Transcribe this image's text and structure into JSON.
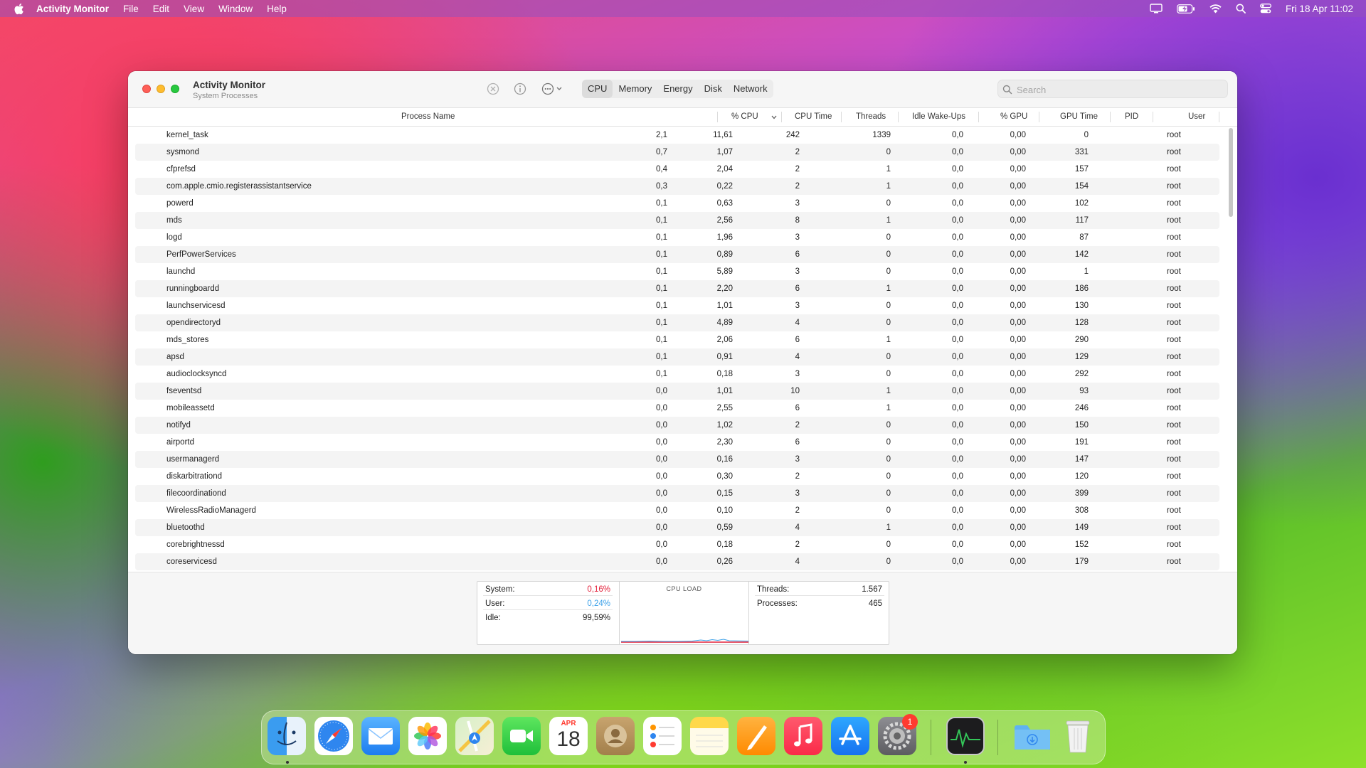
{
  "menubar": {
    "items": [
      "Activity Monitor",
      "File",
      "Edit",
      "View",
      "Window",
      "Help"
    ],
    "clock": "Fri 18 Apr  11:02",
    "status_icons": [
      "display-icon",
      "battery-icon",
      "wifi-icon",
      "search-icon",
      "control-center-icon"
    ]
  },
  "window": {
    "title": "Activity Monitor",
    "subtitle": "System Processes",
    "tabs": [
      "CPU",
      "Memory",
      "Energy",
      "Disk",
      "Network"
    ],
    "active_tab": "CPU",
    "search_placeholder": "Search"
  },
  "columns": [
    "Process Name",
    "% CPU",
    "CPU Time",
    "Threads",
    "Idle Wake-Ups",
    "% GPU",
    "GPU Time",
    "PID",
    "User"
  ],
  "sort_column": "% CPU",
  "processes": [
    {
      "name": "kernel_task",
      "cpu": "2,1",
      "cpu_time": "11,61",
      "threads": "242",
      "idle": "1339",
      "gpu": "0,0",
      "gpu_time": "0,00",
      "pid": "0",
      "user": "root"
    },
    {
      "name": "sysmond",
      "cpu": "0,7",
      "cpu_time": "1,07",
      "threads": "2",
      "idle": "0",
      "gpu": "0,0",
      "gpu_time": "0,00",
      "pid": "331",
      "user": "root"
    },
    {
      "name": "cfprefsd",
      "cpu": "0,4",
      "cpu_time": "2,04",
      "threads": "2",
      "idle": "1",
      "gpu": "0,0",
      "gpu_time": "0,00",
      "pid": "157",
      "user": "root"
    },
    {
      "name": "com.apple.cmio.registerassistantservice",
      "cpu": "0,3",
      "cpu_time": "0,22",
      "threads": "2",
      "idle": "1",
      "gpu": "0,0",
      "gpu_time": "0,00",
      "pid": "154",
      "user": "root"
    },
    {
      "name": "powerd",
      "cpu": "0,1",
      "cpu_time": "0,63",
      "threads": "3",
      "idle": "0",
      "gpu": "0,0",
      "gpu_time": "0,00",
      "pid": "102",
      "user": "root"
    },
    {
      "name": "mds",
      "cpu": "0,1",
      "cpu_time": "2,56",
      "threads": "8",
      "idle": "1",
      "gpu": "0,0",
      "gpu_time": "0,00",
      "pid": "117",
      "user": "root"
    },
    {
      "name": "logd",
      "cpu": "0,1",
      "cpu_time": "1,96",
      "threads": "3",
      "idle": "0",
      "gpu": "0,0",
      "gpu_time": "0,00",
      "pid": "87",
      "user": "root"
    },
    {
      "name": "PerfPowerServices",
      "cpu": "0,1",
      "cpu_time": "0,89",
      "threads": "6",
      "idle": "0",
      "gpu": "0,0",
      "gpu_time": "0,00",
      "pid": "142",
      "user": "root"
    },
    {
      "name": "launchd",
      "cpu": "0,1",
      "cpu_time": "5,89",
      "threads": "3",
      "idle": "0",
      "gpu": "0,0",
      "gpu_time": "0,00",
      "pid": "1",
      "user": "root"
    },
    {
      "name": "runningboardd",
      "cpu": "0,1",
      "cpu_time": "2,20",
      "threads": "6",
      "idle": "1",
      "gpu": "0,0",
      "gpu_time": "0,00",
      "pid": "186",
      "user": "root"
    },
    {
      "name": "launchservicesd",
      "cpu": "0,1",
      "cpu_time": "1,01",
      "threads": "3",
      "idle": "0",
      "gpu": "0,0",
      "gpu_time": "0,00",
      "pid": "130",
      "user": "root"
    },
    {
      "name": "opendirectoryd",
      "cpu": "0,1",
      "cpu_time": "4,89",
      "threads": "4",
      "idle": "0",
      "gpu": "0,0",
      "gpu_time": "0,00",
      "pid": "128",
      "user": "root"
    },
    {
      "name": "mds_stores",
      "cpu": "0,1",
      "cpu_time": "2,06",
      "threads": "6",
      "idle": "1",
      "gpu": "0,0",
      "gpu_time": "0,00",
      "pid": "290",
      "user": "root"
    },
    {
      "name": "apsd",
      "cpu": "0,1",
      "cpu_time": "0,91",
      "threads": "4",
      "idle": "0",
      "gpu": "0,0",
      "gpu_time": "0,00",
      "pid": "129",
      "user": "root"
    },
    {
      "name": "audioclocksyncd",
      "cpu": "0,1",
      "cpu_time": "0,18",
      "threads": "3",
      "idle": "0",
      "gpu": "0,0",
      "gpu_time": "0,00",
      "pid": "292",
      "user": "root"
    },
    {
      "name": "fseventsd",
      "cpu": "0,0",
      "cpu_time": "1,01",
      "threads": "10",
      "idle": "1",
      "gpu": "0,0",
      "gpu_time": "0,00",
      "pid": "93",
      "user": "root"
    },
    {
      "name": "mobileassetd",
      "cpu": "0,0",
      "cpu_time": "2,55",
      "threads": "6",
      "idle": "1",
      "gpu": "0,0",
      "gpu_time": "0,00",
      "pid": "246",
      "user": "root"
    },
    {
      "name": "notifyd",
      "cpu": "0,0",
      "cpu_time": "1,02",
      "threads": "2",
      "idle": "0",
      "gpu": "0,0",
      "gpu_time": "0,00",
      "pid": "150",
      "user": "root"
    },
    {
      "name": "airportd",
      "cpu": "0,0",
      "cpu_time": "2,30",
      "threads": "6",
      "idle": "0",
      "gpu": "0,0",
      "gpu_time": "0,00",
      "pid": "191",
      "user": "root"
    },
    {
      "name": "usermanagerd",
      "cpu": "0,0",
      "cpu_time": "0,16",
      "threads": "3",
      "idle": "0",
      "gpu": "0,0",
      "gpu_time": "0,00",
      "pid": "147",
      "user": "root"
    },
    {
      "name": "diskarbitrationd",
      "cpu": "0,0",
      "cpu_time": "0,30",
      "threads": "2",
      "idle": "0",
      "gpu": "0,0",
      "gpu_time": "0,00",
      "pid": "120",
      "user": "root"
    },
    {
      "name": "filecoordinationd",
      "cpu": "0,0",
      "cpu_time": "0,15",
      "threads": "3",
      "idle": "0",
      "gpu": "0,0",
      "gpu_time": "0,00",
      "pid": "399",
      "user": "root"
    },
    {
      "name": "WirelessRadioManagerd",
      "cpu": "0,0",
      "cpu_time": "0,10",
      "threads": "2",
      "idle": "0",
      "gpu": "0,0",
      "gpu_time": "0,00",
      "pid": "308",
      "user": "root"
    },
    {
      "name": "bluetoothd",
      "cpu": "0,0",
      "cpu_time": "0,59",
      "threads": "4",
      "idle": "1",
      "gpu": "0,0",
      "gpu_time": "0,00",
      "pid": "149",
      "user": "root"
    },
    {
      "name": "corebrightnessd",
      "cpu": "0,0",
      "cpu_time": "0,18",
      "threads": "2",
      "idle": "0",
      "gpu": "0,0",
      "gpu_time": "0,00",
      "pid": "152",
      "user": "root"
    },
    {
      "name": "coreservicesd",
      "cpu": "0,0",
      "cpu_time": "0,26",
      "threads": "4",
      "idle": "0",
      "gpu": "0,0",
      "gpu_time": "0,00",
      "pid": "179",
      "user": "root"
    }
  ],
  "summary": {
    "system_label": "System:",
    "system_value": "0,16%",
    "user_label": "User:",
    "user_value": "0,24%",
    "idle_label": "Idle:",
    "idle_value": "99,59%",
    "graph_title": "CPU LOAD",
    "threads_label": "Threads:",
    "threads_value": "1.567",
    "processes_label": "Processes:",
    "processes_value": "465"
  },
  "colors": {
    "system": "#e3203a",
    "user": "#3aa0e8",
    "close": "#fe5f57",
    "minimize": "#febc2e",
    "zoom": "#28c840"
  },
  "dock": {
    "apps": [
      "Finder",
      "Safari",
      "Mail",
      "Photos",
      "Maps",
      "FaceTime",
      "Calendar",
      "Contacts",
      "Reminders",
      "Notes",
      "Pages",
      "Music",
      "App Store",
      "System Settings",
      "Activity Monitor",
      "Downloads",
      "Trash"
    ],
    "calendar_month": "APR",
    "calendar_day": "18",
    "settings_badge": "1"
  }
}
